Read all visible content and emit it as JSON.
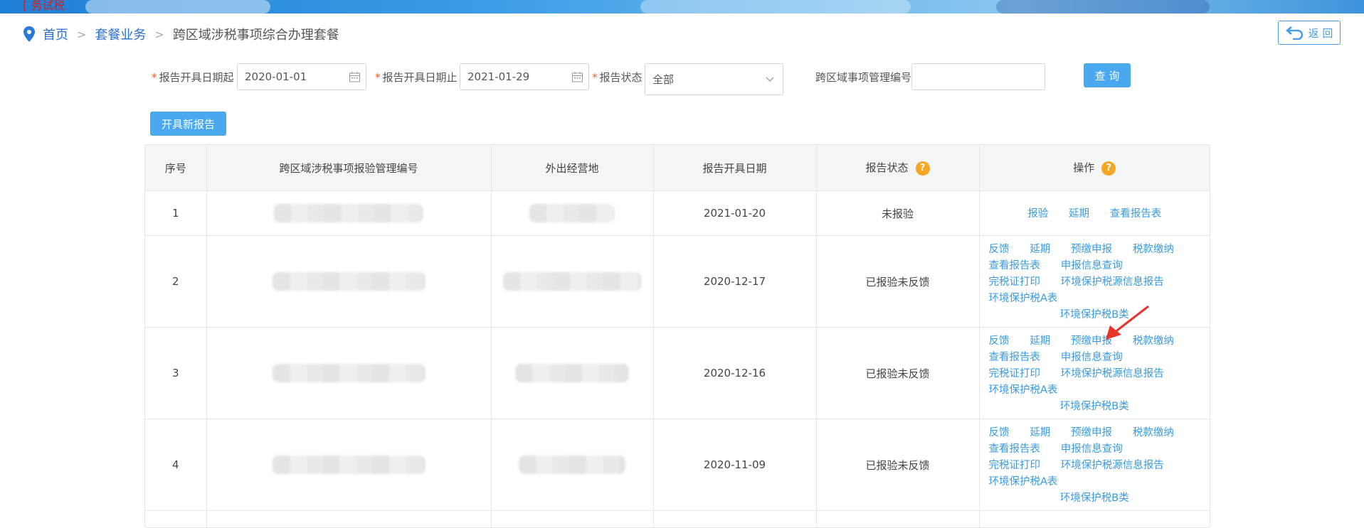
{
  "banner": {
    "logo_text": "[ 务试税"
  },
  "breadcrumb": {
    "home": "首页",
    "parent": "套餐业务",
    "current": "跨区域涉税事项综合办理套餐"
  },
  "back_button": {
    "label": "返 回"
  },
  "filters": {
    "start_date_label": "报告开具日期起",
    "start_date_value": "2020-01-01",
    "end_date_label": "报告开具日期止",
    "end_date_value": "2021-01-29",
    "status_label": "报告状态",
    "status_value": "全部",
    "manage_no_label": "跨区域事项管理编号",
    "manage_no_value": "",
    "query_button": "查 询",
    "required_mark": "*"
  },
  "new_report_button": "开具新报告",
  "table": {
    "columns": [
      "序号",
      "跨区域涉税事项报验管理编号",
      "外出经营地",
      "报告开具日期",
      "报告状态",
      "操作"
    ],
    "help_icon": "?",
    "rows": [
      {
        "seq": "1",
        "date": "2021-01-20",
        "status": "未报验",
        "ops": [
          "报验",
          "延期",
          "查看报告表"
        ]
      },
      {
        "seq": "2",
        "date": "2020-12-17",
        "status": "已报验未反馈",
        "ops": [
          "反馈",
          "延期",
          "预缴申报",
          "税款缴纳",
          "查看报告表",
          "申报信息查询",
          "完税证打印",
          "环境保护税源信息报告",
          "环境保护税A表",
          "环境保护税B类"
        ]
      },
      {
        "seq": "3",
        "date": "2020-12-16",
        "status": "已报验未反馈",
        "ops": [
          "反馈",
          "延期",
          "预缴申报",
          "税款缴纳",
          "查看报告表",
          "申报信息查询",
          "完税证打印",
          "环境保护税源信息报告",
          "环境保护税A表",
          "环境保护税B类"
        ]
      },
      {
        "seq": "4",
        "date": "2020-11-09",
        "status": "已报验未反馈",
        "ops": [
          "反馈",
          "延期",
          "预缴申报",
          "税款缴纳",
          "查看报告表",
          "申报信息查询",
          "完税证打印",
          "环境保护税源信息报告",
          "环境保护税A表",
          "环境保护税B类"
        ]
      }
    ]
  },
  "colors": {
    "accent": "#4aa8ee",
    "link": "#3a9ae0",
    "help": "#f5a623",
    "arrow": "#e8332a"
  },
  "icons": [
    "location-pin-icon",
    "back-arrow-icon",
    "calendar-icon",
    "chevron-down-icon",
    "help-icon",
    "red-arrow-icon"
  ]
}
